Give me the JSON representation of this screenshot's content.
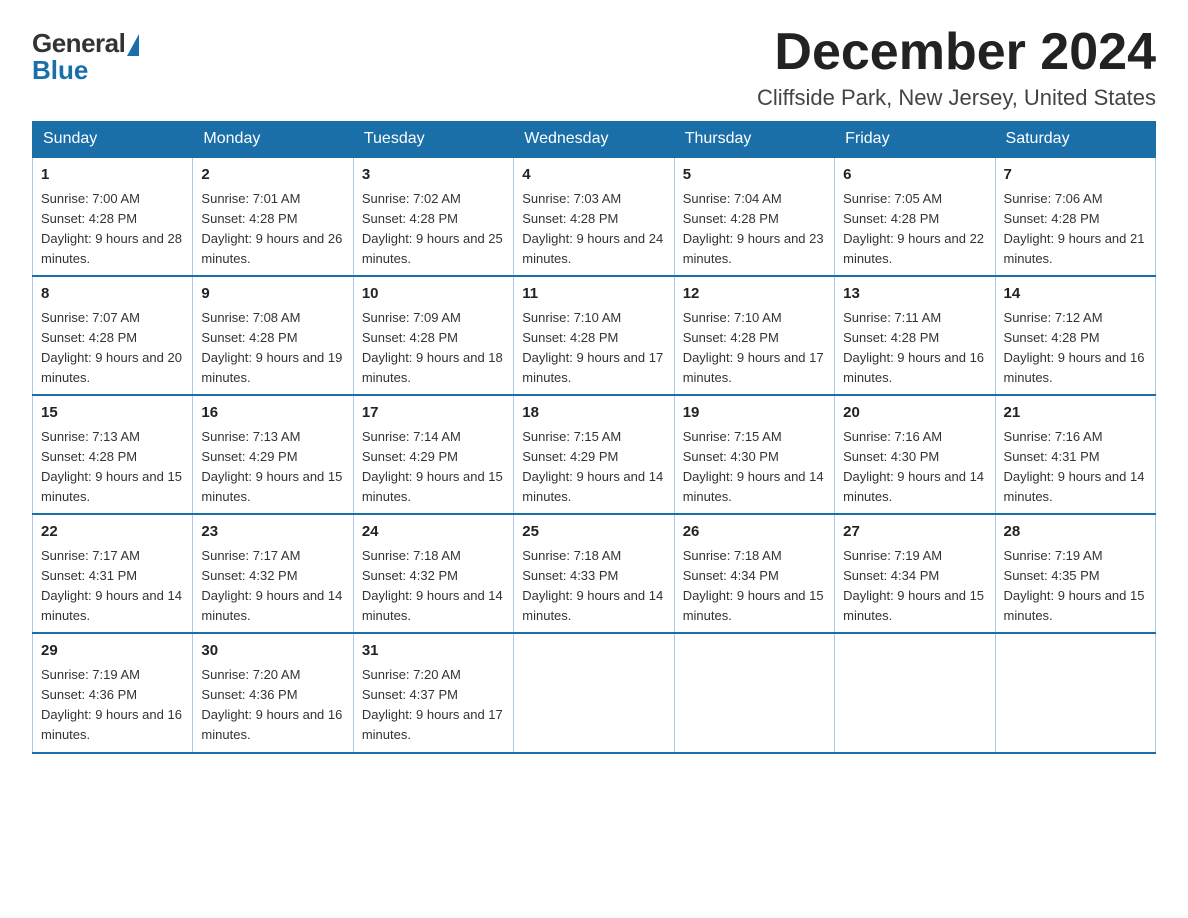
{
  "logo": {
    "general": "General",
    "blue": "Blue"
  },
  "title": "December 2024",
  "location": "Cliffside Park, New Jersey, United States",
  "days_of_week": [
    "Sunday",
    "Monday",
    "Tuesday",
    "Wednesday",
    "Thursday",
    "Friday",
    "Saturday"
  ],
  "weeks": [
    [
      {
        "day": "1",
        "sunrise": "7:00 AM",
        "sunset": "4:28 PM",
        "daylight": "9 hours and 28 minutes."
      },
      {
        "day": "2",
        "sunrise": "7:01 AM",
        "sunset": "4:28 PM",
        "daylight": "9 hours and 26 minutes."
      },
      {
        "day": "3",
        "sunrise": "7:02 AM",
        "sunset": "4:28 PM",
        "daylight": "9 hours and 25 minutes."
      },
      {
        "day": "4",
        "sunrise": "7:03 AM",
        "sunset": "4:28 PM",
        "daylight": "9 hours and 24 minutes."
      },
      {
        "day": "5",
        "sunrise": "7:04 AM",
        "sunset": "4:28 PM",
        "daylight": "9 hours and 23 minutes."
      },
      {
        "day": "6",
        "sunrise": "7:05 AM",
        "sunset": "4:28 PM",
        "daylight": "9 hours and 22 minutes."
      },
      {
        "day": "7",
        "sunrise": "7:06 AM",
        "sunset": "4:28 PM",
        "daylight": "9 hours and 21 minutes."
      }
    ],
    [
      {
        "day": "8",
        "sunrise": "7:07 AM",
        "sunset": "4:28 PM",
        "daylight": "9 hours and 20 minutes."
      },
      {
        "day": "9",
        "sunrise": "7:08 AM",
        "sunset": "4:28 PM",
        "daylight": "9 hours and 19 minutes."
      },
      {
        "day": "10",
        "sunrise": "7:09 AM",
        "sunset": "4:28 PM",
        "daylight": "9 hours and 18 minutes."
      },
      {
        "day": "11",
        "sunrise": "7:10 AM",
        "sunset": "4:28 PM",
        "daylight": "9 hours and 17 minutes."
      },
      {
        "day": "12",
        "sunrise": "7:10 AM",
        "sunset": "4:28 PM",
        "daylight": "9 hours and 17 minutes."
      },
      {
        "day": "13",
        "sunrise": "7:11 AM",
        "sunset": "4:28 PM",
        "daylight": "9 hours and 16 minutes."
      },
      {
        "day": "14",
        "sunrise": "7:12 AM",
        "sunset": "4:28 PM",
        "daylight": "9 hours and 16 minutes."
      }
    ],
    [
      {
        "day": "15",
        "sunrise": "7:13 AM",
        "sunset": "4:28 PM",
        "daylight": "9 hours and 15 minutes."
      },
      {
        "day": "16",
        "sunrise": "7:13 AM",
        "sunset": "4:29 PM",
        "daylight": "9 hours and 15 minutes."
      },
      {
        "day": "17",
        "sunrise": "7:14 AM",
        "sunset": "4:29 PM",
        "daylight": "9 hours and 15 minutes."
      },
      {
        "day": "18",
        "sunrise": "7:15 AM",
        "sunset": "4:29 PM",
        "daylight": "9 hours and 14 minutes."
      },
      {
        "day": "19",
        "sunrise": "7:15 AM",
        "sunset": "4:30 PM",
        "daylight": "9 hours and 14 minutes."
      },
      {
        "day": "20",
        "sunrise": "7:16 AM",
        "sunset": "4:30 PM",
        "daylight": "9 hours and 14 minutes."
      },
      {
        "day": "21",
        "sunrise": "7:16 AM",
        "sunset": "4:31 PM",
        "daylight": "9 hours and 14 minutes."
      }
    ],
    [
      {
        "day": "22",
        "sunrise": "7:17 AM",
        "sunset": "4:31 PM",
        "daylight": "9 hours and 14 minutes."
      },
      {
        "day": "23",
        "sunrise": "7:17 AM",
        "sunset": "4:32 PM",
        "daylight": "9 hours and 14 minutes."
      },
      {
        "day": "24",
        "sunrise": "7:18 AM",
        "sunset": "4:32 PM",
        "daylight": "9 hours and 14 minutes."
      },
      {
        "day": "25",
        "sunrise": "7:18 AM",
        "sunset": "4:33 PM",
        "daylight": "9 hours and 14 minutes."
      },
      {
        "day": "26",
        "sunrise": "7:18 AM",
        "sunset": "4:34 PM",
        "daylight": "9 hours and 15 minutes."
      },
      {
        "day": "27",
        "sunrise": "7:19 AM",
        "sunset": "4:34 PM",
        "daylight": "9 hours and 15 minutes."
      },
      {
        "day": "28",
        "sunrise": "7:19 AM",
        "sunset": "4:35 PM",
        "daylight": "9 hours and 15 minutes."
      }
    ],
    [
      {
        "day": "29",
        "sunrise": "7:19 AM",
        "sunset": "4:36 PM",
        "daylight": "9 hours and 16 minutes."
      },
      {
        "day": "30",
        "sunrise": "7:20 AM",
        "sunset": "4:36 PM",
        "daylight": "9 hours and 16 minutes."
      },
      {
        "day": "31",
        "sunrise": "7:20 AM",
        "sunset": "4:37 PM",
        "daylight": "9 hours and 17 minutes."
      },
      null,
      null,
      null,
      null
    ]
  ]
}
